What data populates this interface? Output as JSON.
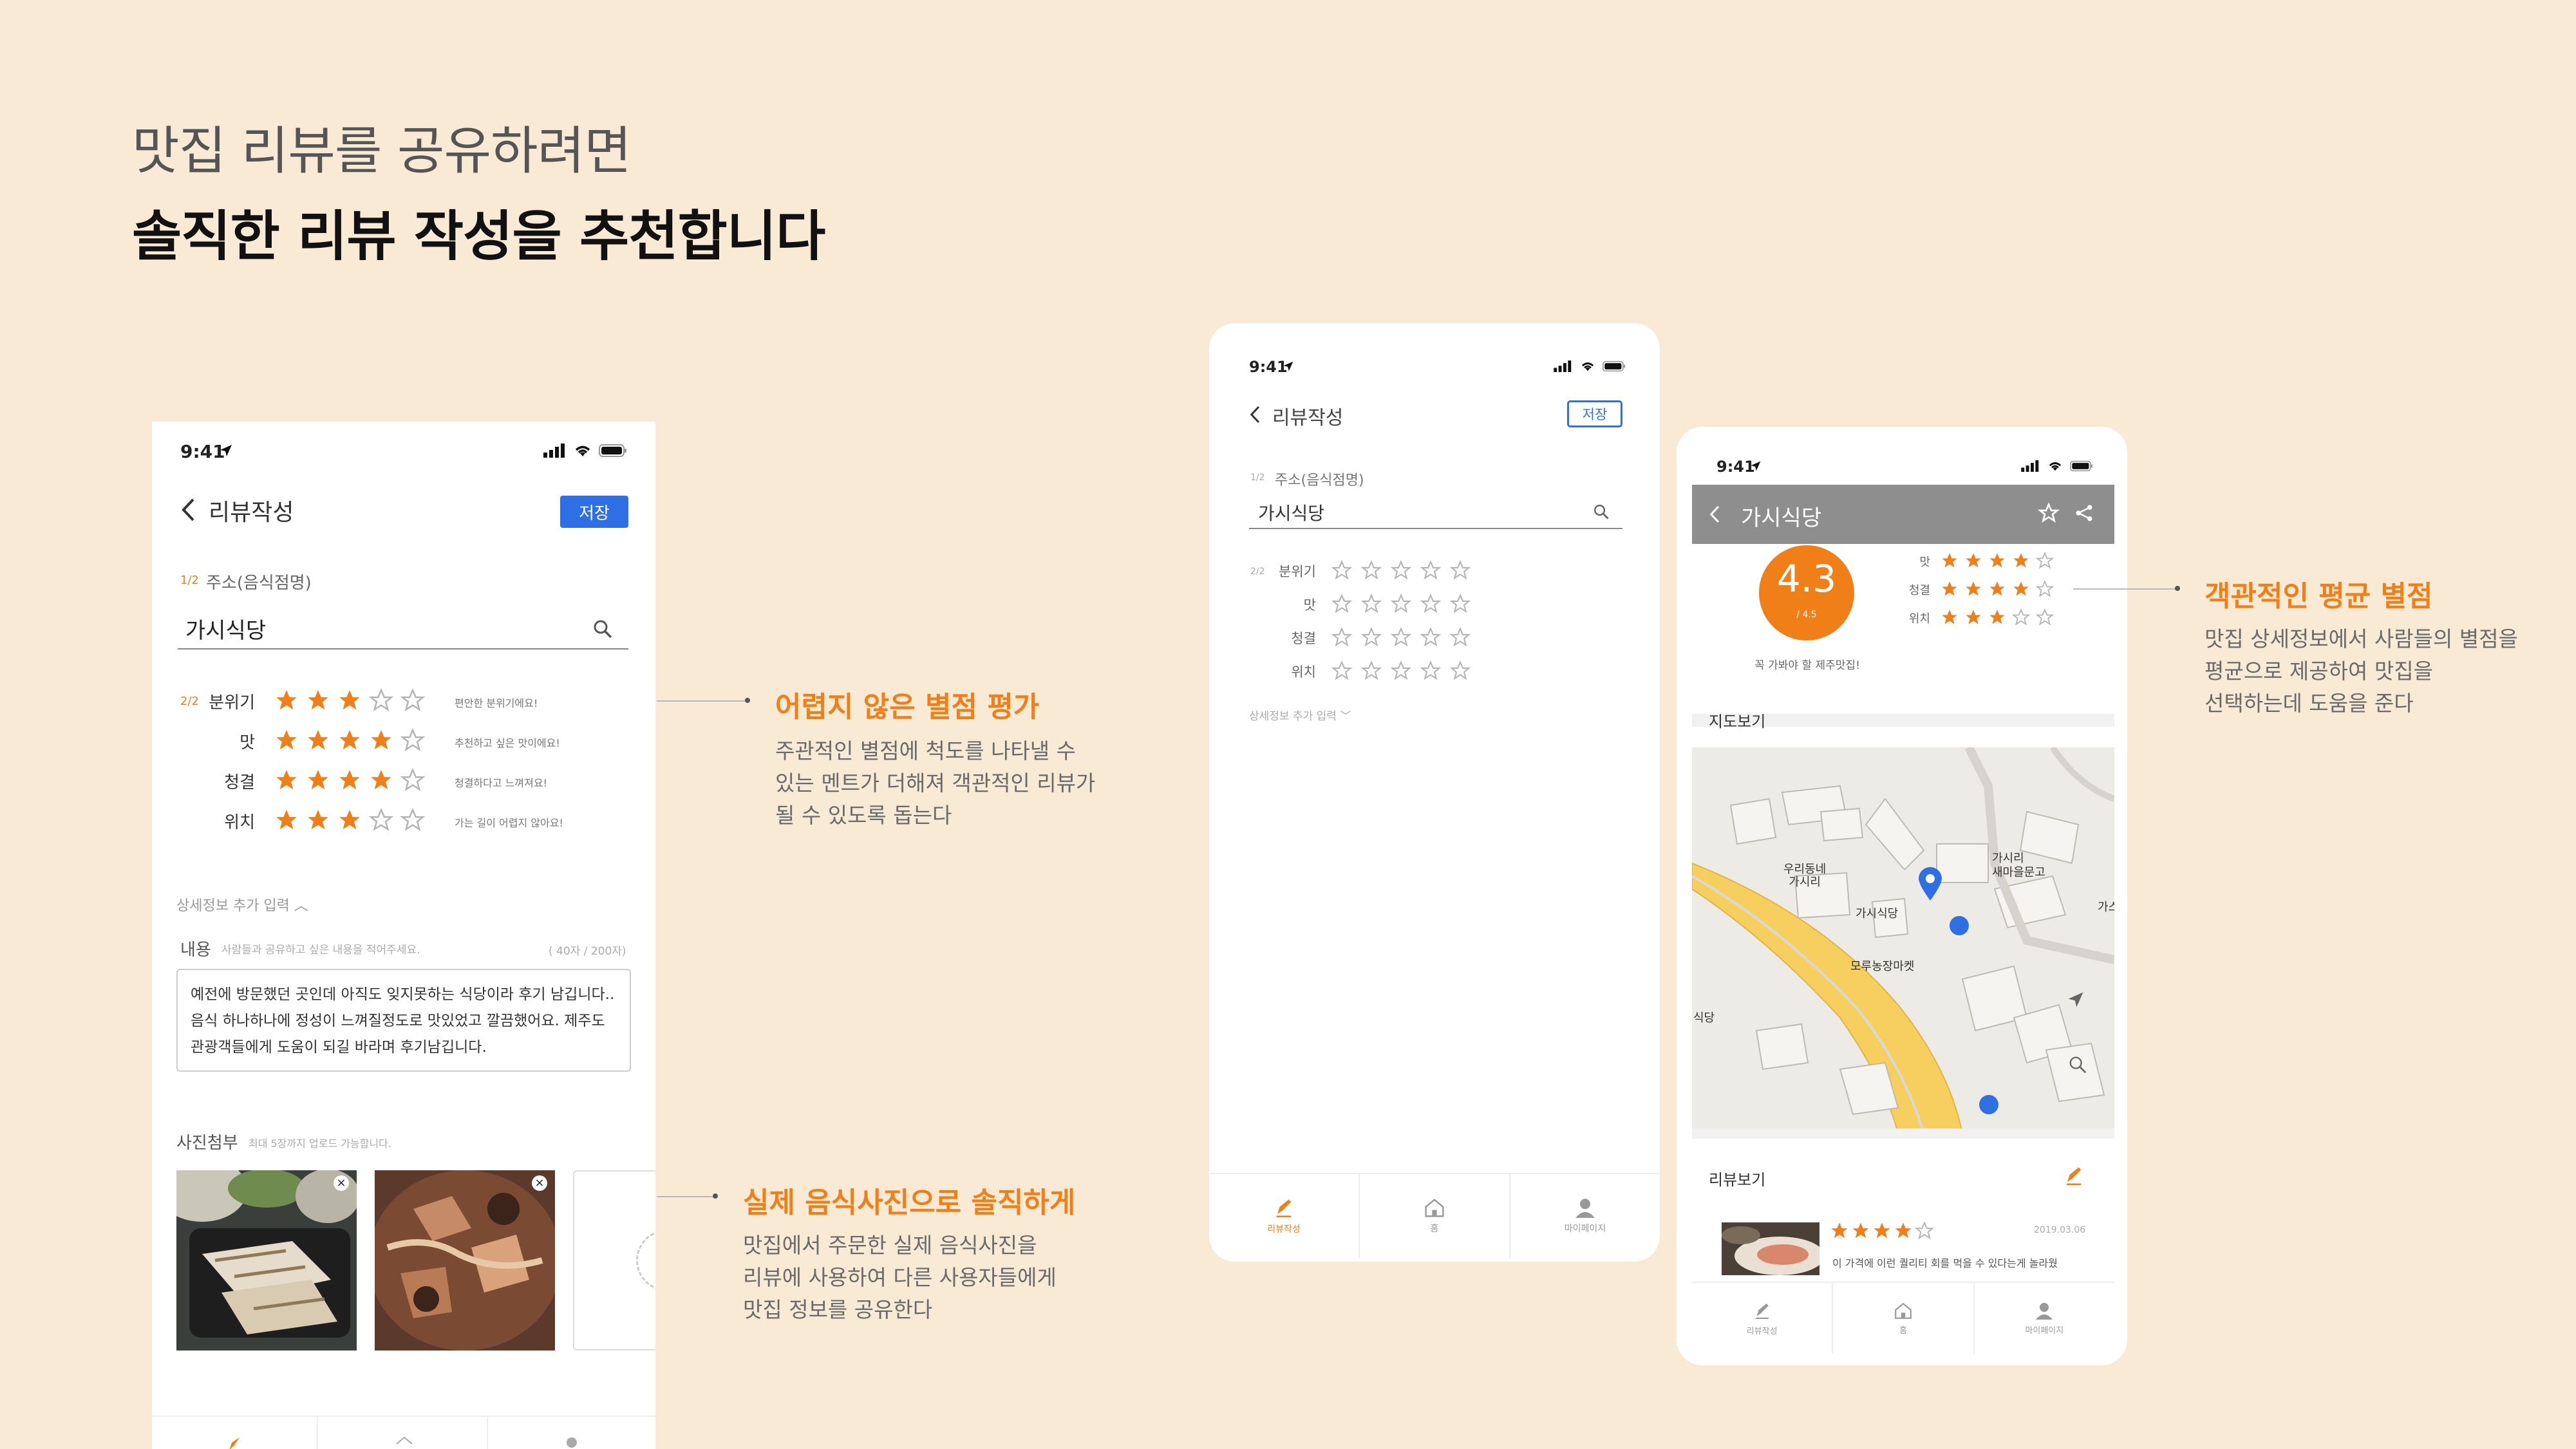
{
  "headline": {
    "line1": "맛집 리뷰를 공유하려면",
    "line2": "솔직한 리뷰 작성을 추천합니다"
  },
  "status_time": "9:41",
  "colors": {
    "background": "#f8ead5",
    "accent": "#f07f17",
    "save_blue": "#2f6fe4",
    "star_off": "#9a9a9a"
  },
  "phone1": {
    "title": "리뷰작성",
    "save_label": "저장",
    "step1_num": "1/2",
    "step1_label": "주소(음식점명)",
    "restaurant": "가시식당",
    "step2_num": "2/2",
    "ratings": [
      {
        "label": "분위기",
        "stars": 3,
        "comment": "편안한 분위기에요!"
      },
      {
        "label": "맛",
        "stars": 4,
        "comment": "추천하고 싶은 맛이에요!"
      },
      {
        "label": "청결",
        "stars": 4,
        "comment": "청결하다고 느껴져요!"
      },
      {
        "label": "위치",
        "stars": 3,
        "comment": "가는 길이 어렵지 않아요!"
      }
    ],
    "detail_toggle": "상세정보 추가 입력",
    "content_label": "내용",
    "content_hint": "사람들과 공유하고 싶은 내용을 적어주세요.",
    "content_count": "( 40자 / 200자)",
    "content_text": "예전에 방문했던 곳인데 아직도 잊지못하는 식당이라 후기 남깁니다.. 음식 하나하나에 정성이 느껴질정도로 맛있었고 깔끔했어요. 제주도 관광객들에게 도움이 되길 바라며 후기남깁니다.",
    "photo_label": "사진첨부",
    "photo_hint": "최대 5장까지 업로드 가능합니다."
  },
  "phone2": {
    "title": "리뷰작성",
    "save_label": "저장",
    "step1_num": "1/2",
    "step1_label": "주소(음식점명)",
    "restaurant": "가시식당",
    "step2_num": "2/2",
    "ratings": [
      {
        "label": "분위기"
      },
      {
        "label": "맛"
      },
      {
        "label": "청결"
      },
      {
        "label": "위치"
      }
    ],
    "detail_toggle": "상세정보 추가 입력",
    "tabs": [
      "리뷰작성",
      "홈",
      "마이페이지"
    ]
  },
  "phone3": {
    "title": "가시식당",
    "score": "4.3",
    "score_max": "/ 4.5",
    "score_caption": "꼭 가봐야 할 제주맛집!",
    "ratings": [
      {
        "label": "맛",
        "stars": 4
      },
      {
        "label": "청결",
        "stars": 4
      },
      {
        "label": "위치",
        "stars": 3
      }
    ],
    "map_title": "지도보기",
    "map_labels": {
      "pin": "가시식당",
      "woori": "우리동네\n가시리",
      "saemaeul": "가시리\n새마을문고",
      "moru": "모루농장마켓",
      "gasi": "가스",
      "left": "식당"
    },
    "review_title": "리뷰보기",
    "review_date": "2019.03.06",
    "review_stars": 4,
    "review_text": "이 가격에 이런 퀄리티 회를 먹을 수 있다는게 놀라웠",
    "tabs": [
      "리뷰작성",
      "홈",
      "마이페이지"
    ]
  },
  "callouts": [
    {
      "title": "어렵지 않은 별점 평가",
      "desc": "주관적인 별점에 척도를 나타낼 수\n있는 멘트가 더해져 객관적인 리뷰가\n될 수 있도록 돕는다"
    },
    {
      "title": "실제 음식사진으로 솔직하게",
      "desc": "맛집에서 주문한 실제 음식사진을\n리뷰에 사용하여 다른 사용자들에게\n맛집 정보를 공유한다"
    },
    {
      "title": "객관적인 평균 별점",
      "desc": "맛집 상세정보에서 사람들의 별점을\n평균으로 제공하여 맛집을\n선택하는데 도움을 준다"
    }
  ]
}
